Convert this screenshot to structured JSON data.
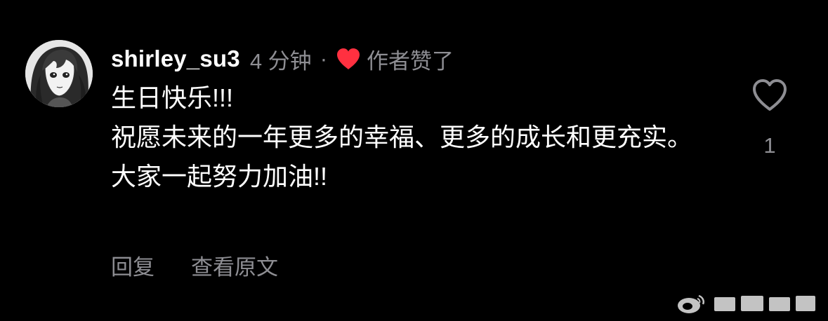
{
  "comment": {
    "username": "shirley_su3",
    "time": "4 分钟",
    "separator": "·",
    "author_liked_label": "作者赞了",
    "lines": [
      "生日快乐!!!",
      "祝愿未来的一年更多的幸福、更多的成长和更充实。",
      "大家一起努力加油!!"
    ],
    "actions": {
      "reply": "回复",
      "view_original": "查看原文"
    },
    "like_count": "1"
  },
  "icons": {
    "author_heart": "heart-filled-icon",
    "like": "heart-outline-icon",
    "avatar": "avatar-manga-girl"
  },
  "colors": {
    "background": "#000000",
    "text_primary": "#ffffff",
    "text_secondary": "#8e8e93",
    "heart_red": "#ff3040"
  }
}
